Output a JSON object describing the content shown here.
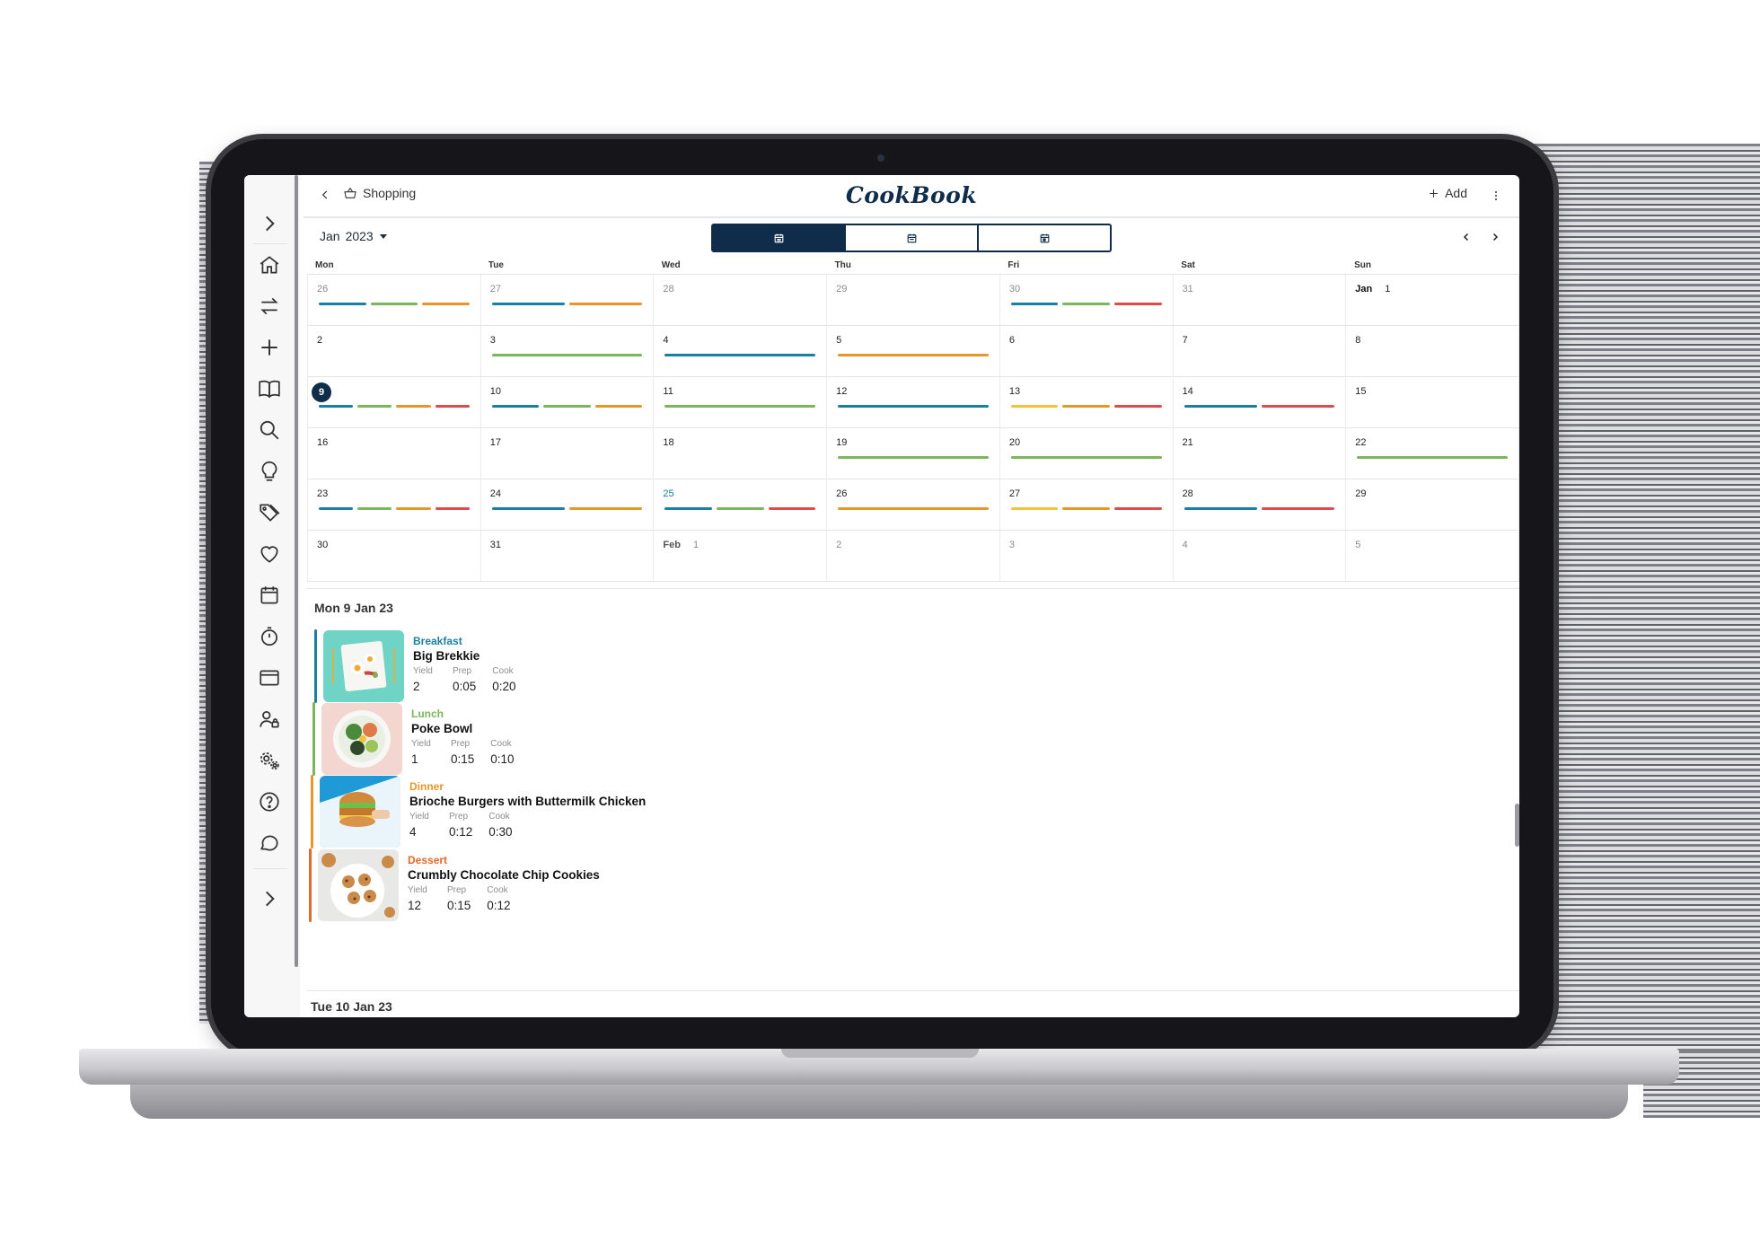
{
  "app": {
    "logo": "CookBook"
  },
  "topbar": {
    "breadcrumb": "Shopping",
    "add_label": "Add"
  },
  "sidebar": {
    "items": [
      {
        "name": "expand-icon"
      },
      {
        "name": "home-icon"
      },
      {
        "name": "swap-icon"
      },
      {
        "name": "plus-icon"
      },
      {
        "name": "book-icon"
      },
      {
        "name": "search-icon"
      },
      {
        "name": "lightbulb-icon"
      },
      {
        "name": "tags-icon"
      },
      {
        "name": "heart-icon"
      },
      {
        "name": "calendar-icon"
      },
      {
        "name": "timer-icon"
      },
      {
        "name": "browser-icon"
      },
      {
        "name": "user-lock-icon"
      },
      {
        "name": "settings-icon"
      },
      {
        "name": "help-icon"
      },
      {
        "name": "chat-icon"
      },
      {
        "name": "collapse-icon"
      }
    ]
  },
  "calendar": {
    "month_label": "Jan",
    "year_label": "2023",
    "weekdays": [
      "Mon",
      "Tue",
      "Wed",
      "Thu",
      "Fri",
      "Sat",
      "Sun"
    ],
    "colors": {
      "blue": "#1a7fa0",
      "green": "#7cb55a",
      "orange": "#e8962a",
      "red": "#e04a4a",
      "yellow": "#f2c23a",
      "navy": "#0f2d4a"
    },
    "cells": [
      {
        "day": "26",
        "other": true,
        "bars": [
          "blue",
          "green",
          "orange"
        ]
      },
      {
        "day": "27",
        "other": true,
        "bars": [
          "blue",
          "orange"
        ]
      },
      {
        "day": "28",
        "other": true,
        "bars": []
      },
      {
        "day": "29",
        "other": true,
        "bars": []
      },
      {
        "day": "30",
        "other": true,
        "bars": [
          "blue",
          "green",
          "red"
        ]
      },
      {
        "day": "31",
        "other": true,
        "bars": []
      },
      {
        "day": "1",
        "prefix": "Jan",
        "bars": []
      },
      {
        "day": "2",
        "bars": []
      },
      {
        "day": "3",
        "bars": [
          "green"
        ]
      },
      {
        "day": "4",
        "bars": [
          "blue"
        ]
      },
      {
        "day": "5",
        "bars": [
          "orange"
        ]
      },
      {
        "day": "6",
        "bars": []
      },
      {
        "day": "7",
        "bars": []
      },
      {
        "day": "8",
        "bars": []
      },
      {
        "day": "9",
        "today": true,
        "bars": [
          "blue",
          "green",
          "orange",
          "red"
        ]
      },
      {
        "day": "10",
        "bars": [
          "blue",
          "green",
          "orange"
        ]
      },
      {
        "day": "11",
        "bars": [
          "green"
        ]
      },
      {
        "day": "12",
        "bars": [
          "blue"
        ]
      },
      {
        "day": "13",
        "bars": [
          "yellow",
          "orange",
          "red"
        ]
      },
      {
        "day": "14",
        "bars": [
          "blue",
          "red"
        ]
      },
      {
        "day": "15",
        "bars": []
      },
      {
        "day": "16",
        "bars": []
      },
      {
        "day": "17",
        "bars": []
      },
      {
        "day": "18",
        "bars": []
      },
      {
        "day": "19",
        "bars": [
          "green"
        ]
      },
      {
        "day": "20",
        "bars": [
          "green"
        ]
      },
      {
        "day": "21",
        "bars": []
      },
      {
        "day": "22",
        "bars": [
          "green"
        ]
      },
      {
        "day": "23",
        "bars": [
          "blue",
          "green",
          "orange",
          "red"
        ]
      },
      {
        "day": "24",
        "bars": [
          "blue",
          "orange"
        ]
      },
      {
        "day": "25",
        "teal": true,
        "bars": [
          "blue",
          "green",
          "red"
        ]
      },
      {
        "day": "26",
        "bars": [
          "orange"
        ]
      },
      {
        "day": "27",
        "bars": [
          "yellow",
          "orange",
          "red"
        ]
      },
      {
        "day": "28",
        "bars": [
          "blue",
          "red"
        ]
      },
      {
        "day": "29",
        "bars": []
      },
      {
        "day": "30",
        "bars": []
      },
      {
        "day": "31",
        "bars": []
      },
      {
        "day": "1",
        "prefix": "Feb",
        "other": true,
        "bars": []
      },
      {
        "day": "2",
        "other": true,
        "bars": []
      },
      {
        "day": "3",
        "other": true,
        "bars": []
      },
      {
        "day": "4",
        "other": true,
        "bars": []
      },
      {
        "day": "5",
        "other": true,
        "bars": []
      }
    ]
  },
  "day_detail": {
    "title": "Mon 9 Jan 23",
    "next_title": "Tue 10 Jan 23",
    "stat_labels": {
      "yield": "Yield",
      "prep": "Prep",
      "cook": "Cook"
    },
    "meals": [
      {
        "type": "Breakfast",
        "type_color": "#1a7fa0",
        "accent": "#1a7fa0",
        "name": "Big Brekkie",
        "yield": "2",
        "prep": "0:05",
        "cook": "0:20",
        "image": "breakfast-plate"
      },
      {
        "type": "Lunch",
        "type_color": "#7cb55a",
        "accent": "#7cb55a",
        "name": "Poke Bowl",
        "yield": "1",
        "prep": "0:15",
        "cook": "0:10",
        "image": "poke-bowl"
      },
      {
        "type": "Dinner",
        "type_color": "#e8962a",
        "accent": "#e8962a",
        "name": "Brioche Burgers with Buttermilk Chicken",
        "yield": "4",
        "prep": "0:12",
        "cook": "0:30",
        "image": "burger"
      },
      {
        "type": "Dessert",
        "type_color": "#e06a2a",
        "accent": "#e06a2a",
        "name": "Crumbly Chocolate Chip Cookies",
        "yield": "12",
        "prep": "0:15",
        "cook": "0:12",
        "image": "cookies"
      }
    ]
  }
}
